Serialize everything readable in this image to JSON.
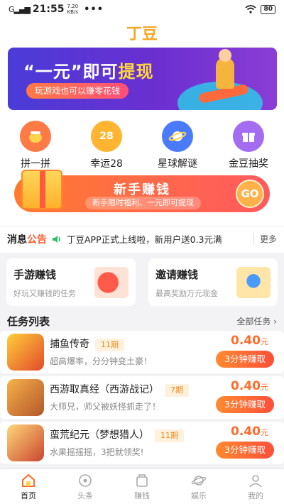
{
  "status": {
    "signal": "G",
    "time": "21:55",
    "speed": "7.20",
    "speed_unit": "KB/s",
    "dots": "•••",
    "battery": "80"
  },
  "header": {
    "logo": "丁豆"
  },
  "banner": {
    "headline_a": "“一元”即可",
    "headline_b": "提现",
    "subtitle": "玩游戏也可以赚零花钱"
  },
  "quick_actions": [
    {
      "label": "拼一拼",
      "icon": "coin-bag-icon",
      "color": "#ff6a3d"
    },
    {
      "label": "幸运28",
      "icon": "lucky28-icon",
      "badge": "28",
      "color": "#ffb531"
    },
    {
      "label": "星球解谜",
      "icon": "planet-icon",
      "color": "#4a7bff"
    },
    {
      "label": "金豆抽奖",
      "icon": "gift-box-icon",
      "color": "#a46cf0"
    }
  ],
  "newbie": {
    "title": "新手赚钱",
    "desc": "新手限时福利、一元即可提现",
    "go": "GO"
  },
  "notice": {
    "label_a": "消息",
    "label_b": "公告",
    "text": "丁豆APP正式上线啦，新用户送0.3元满",
    "more": "更多"
  },
  "cards": [
    {
      "title": "手游赚钱",
      "subtitle": "好玩又赚钱的任务"
    },
    {
      "title": "邀请赚钱",
      "subtitle": "最高奖励万元现金"
    }
  ],
  "tasks_header": {
    "title": "任务列表",
    "all": "全部任务"
  },
  "tasks": [
    {
      "name": "捕鱼传奇",
      "period": "11期",
      "desc": "超高爆率，分分钟变土豪！",
      "reward": "0.40",
      "unit": "元",
      "action": "3分钟赚取"
    },
    {
      "name": "西游取真经（西游战记）",
      "period": "7期",
      "desc": "大师兄，师父被妖怪抓走了！",
      "reward": "0.40",
      "unit": "元",
      "action": "3分钟赚取"
    },
    {
      "name": "蛮荒纪元（梦想猎人）",
      "period": "11期",
      "desc": "水果摇摇摇，3把就领奖!",
      "reward": "0.40",
      "unit": "元",
      "action": "3分钟赚取"
    }
  ],
  "tabbar": [
    {
      "label": "首页",
      "icon": "home-icon",
      "active": true
    },
    {
      "label": "头条",
      "icon": "headline-icon",
      "active": false
    },
    {
      "label": "赚钱",
      "icon": "wallet-icon",
      "active": false
    },
    {
      "label": "娱乐",
      "icon": "planet-icon",
      "active": false
    },
    {
      "label": "我的",
      "icon": "profile-icon",
      "active": false
    }
  ],
  "colors": {
    "accent": "#ff6b2b",
    "brand": "#f5a623"
  }
}
